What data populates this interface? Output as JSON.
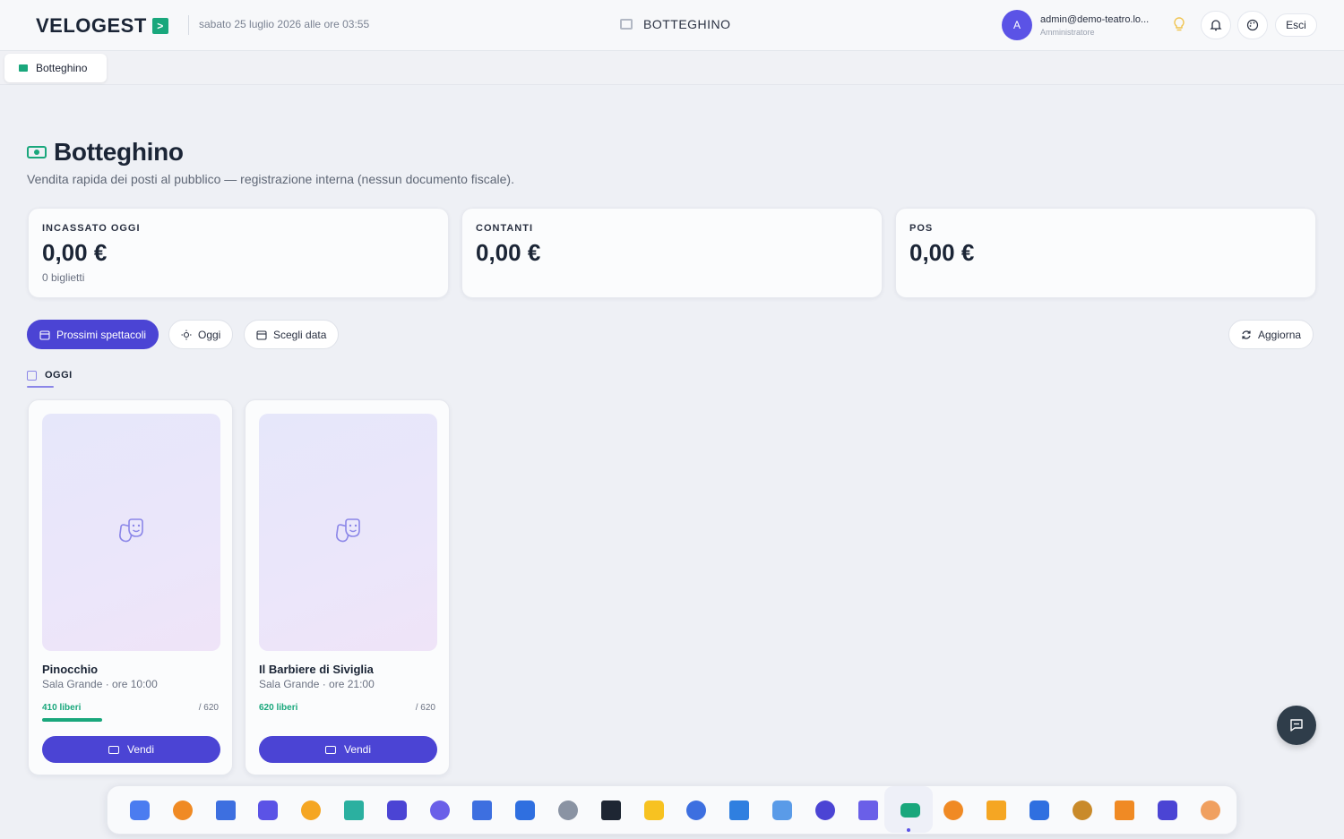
{
  "app": {
    "logo": "VELOGEST",
    "logo_badge": ">",
    "datetime": "sabato 25 luglio 2026 alle ore 03:55",
    "page_center_title": "BOTTEGHINO"
  },
  "user": {
    "avatar_letter": "A",
    "email": "admin@demo-teatro.lo...",
    "role": "Amministratore",
    "logout_label": "Esci"
  },
  "tabs": [
    {
      "label": "Botteghino"
    }
  ],
  "page": {
    "title": "Botteghino",
    "subtitle": "Vendita rapida dei posti al pubblico — registrazione interna (nessun documento fiscale)."
  },
  "stats": [
    {
      "label": "INCASSATO OGGI",
      "value": "0,00 €",
      "sub": "0 biglietti"
    },
    {
      "label": "CONTANTI",
      "value": "0,00 €",
      "sub": ""
    },
    {
      "label": "POS",
      "value": "0,00 €",
      "sub": ""
    }
  ],
  "filters": [
    {
      "label": "Prossimi spettacoli",
      "active": true
    },
    {
      "label": "Oggi",
      "active": false
    },
    {
      "label": "Scegli data",
      "active": false
    }
  ],
  "refresh_label": "Aggiorna",
  "section_label": "OGGI",
  "shows": [
    {
      "title": "Pinocchio",
      "meta": "Sala Grande · ore 10:00",
      "free": "410 liberi",
      "total": "/ 620",
      "sold_fraction": 0.339,
      "button": "Vendi"
    },
    {
      "title": "Il Barbiere di Siviglia",
      "meta": "Sala Grande · ore 21:00",
      "free": "620 liberi",
      "total": "/ 620",
      "sold_fraction": 0.0,
      "button": "Vendi"
    }
  ],
  "dock": [
    "dashboard-icon",
    "calendar-icon",
    "people-icon",
    "network-icon",
    "box-icon",
    "handshake-icon",
    "contact-card-icon",
    "calculator-icon",
    "kanban-icon",
    "headset-icon",
    "trash-icon",
    "terminal-icon",
    "star-icon",
    "building-icon",
    "globe-icon",
    "mail-icon",
    "user-key-icon",
    "camera-icon",
    "ticket-office-icon",
    "stage-icon",
    "theater-masks-icon",
    "school-icon",
    "museum-icon",
    "tickets-icon",
    "home-icon",
    "edit-document-icon"
  ],
  "colors": {
    "accent": "#4b44d4",
    "success": "#19a77c",
    "background": "#eef0f5"
  }
}
